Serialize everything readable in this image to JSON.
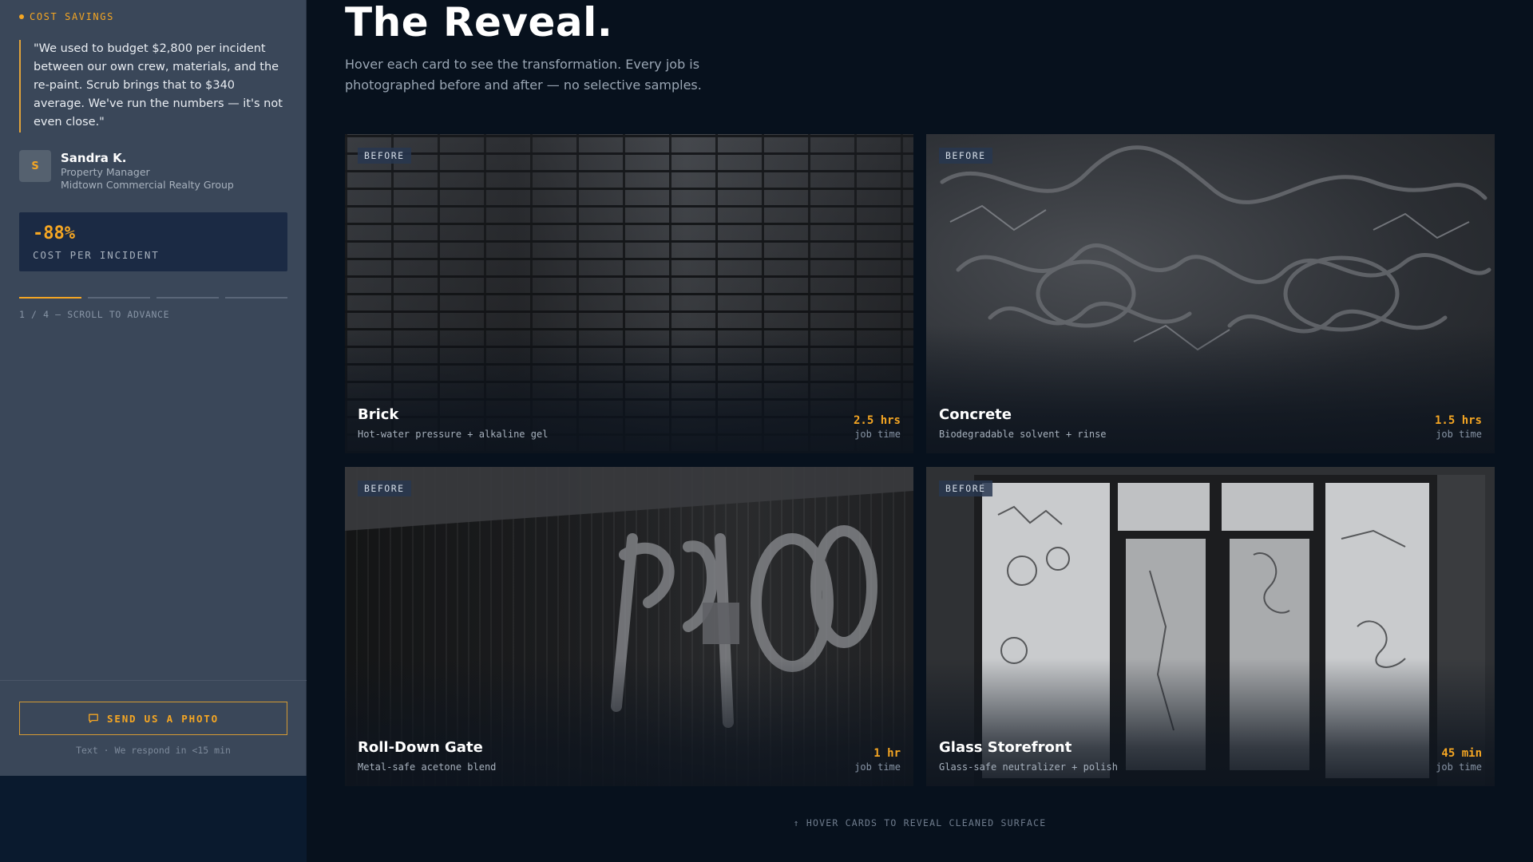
{
  "sidebar": {
    "eyebrow": "COST SAVINGS",
    "quote": "\"We used to budget $2,800 per incident between our own crew, materials, and the re-paint. Scrub brings that to $340 average. We've run the numbers — it's not even close.\"",
    "author": {
      "initial": "S",
      "name": "Sandra K.",
      "role": "Property Manager",
      "company": "Midtown Commercial Realty Group"
    },
    "stat": {
      "value": "-88%",
      "label": "COST PER INCIDENT"
    },
    "progress": {
      "current": 1,
      "total": 4,
      "text": "1 / 4 — SCROLL TO ADVANCE"
    },
    "cta": {
      "label": "SEND US A PHOTO",
      "note": "Text · We respond in <15 min"
    }
  },
  "main": {
    "title": "The Reveal.",
    "subtitle": "Hover each card to see the transformation. Every job is photographed before and after — no selective samples.",
    "cards": [
      {
        "badge": "BEFORE",
        "name": "Brick",
        "method": "Hot-water pressure + alkaline gel",
        "time": "2.5 hrs",
        "time_label": "job time"
      },
      {
        "badge": "BEFORE",
        "name": "Concrete",
        "method": "Biodegradable solvent + rinse",
        "time": "1.5 hrs",
        "time_label": "job time"
      },
      {
        "badge": "BEFORE",
        "name": "Roll-Down Gate",
        "method": "Metal-safe acetone blend",
        "time": "1 hr",
        "time_label": "job time"
      },
      {
        "badge": "BEFORE",
        "name": "Glass Storefront",
        "method": "Glass-safe neutralizer + polish",
        "time": "45 min",
        "time_label": "job time"
      }
    ],
    "hint": "↑ HOVER CARDS TO REVEAL CLEANED SURFACE"
  },
  "colors": {
    "accent": "#f5a623",
    "sidebar_bg": "#3a4759",
    "page_bg": "#07111d",
    "stat_bg": "#1b2a44"
  },
  "icons": {
    "cta": "chat-bubble-icon"
  }
}
